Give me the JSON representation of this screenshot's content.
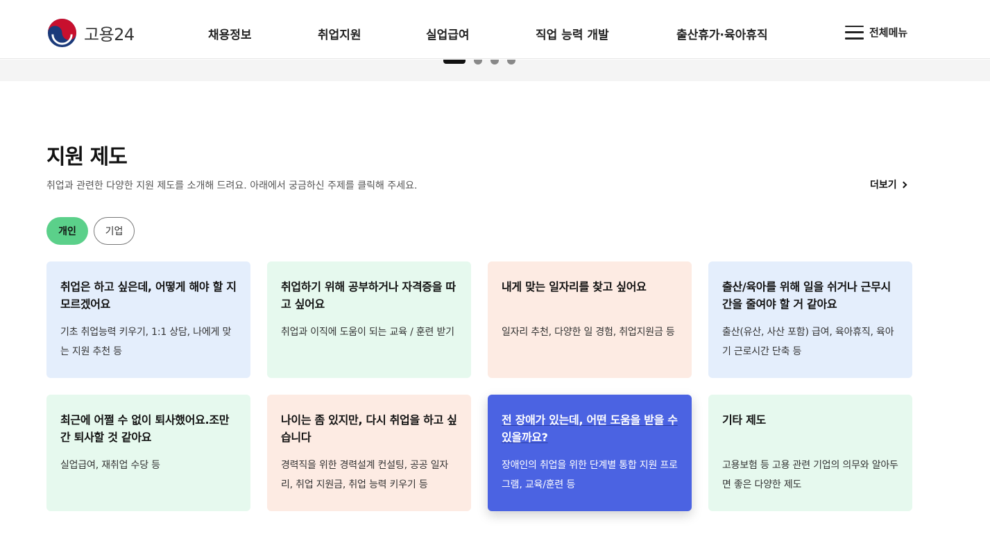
{
  "brand": {
    "logo_text": "고용24",
    "colors": {
      "red": "#c8102e",
      "navy": "#1b3a7a"
    }
  },
  "nav": {
    "items": [
      "채용정보",
      "취업지원",
      "실업급여",
      "직업 능력 개발",
      "출산휴가·육아휴직"
    ],
    "all_menu_label": "전체메뉴"
  },
  "banner": {
    "dot_count": 4,
    "active_dot": 0
  },
  "section": {
    "title": "지원 제도",
    "description": "취업과 관련한 다양한 지원 제도를 소개해 드려요. 아래에서 궁금하신 주제를 클릭해 주세요.",
    "more_label": "더보기"
  },
  "tabs": [
    {
      "label": "개인",
      "selected": true
    },
    {
      "label": "기업",
      "selected": false
    }
  ],
  "cards": [
    {
      "title": "취업은 하고 싶은데, 어떻게 해야 할 지 모르겠어요",
      "desc": "기초 취업능력 키우기, 1:1 상담, 나에게 맞는 지원 추천 등",
      "color": "blue"
    },
    {
      "title": "취업하기 위해 공부하거나 자격증을 따고 싶어요",
      "desc": "취업과 이직에 도움이 되는 교육 / 훈련 받기",
      "color": "green"
    },
    {
      "title": "내게 맞는 일자리를 찾고 싶어요",
      "desc": "일자리 추천, 다양한 일 경험, 취업지원금 등",
      "color": "peach"
    },
    {
      "title": "출산/육아를 위해 일을 쉬거나 근무시간을 줄여야 할 거 같아요",
      "desc": "출산(유산, 사산 포함) 급여, 육아휴직, 육아기 근로시간 단축 등",
      "color": "blue"
    },
    {
      "title": "최근에 어쩔 수 없이 퇴사했어요.조만간 퇴사할 것 같아요",
      "desc": "실업급여, 재취업 수당 등",
      "color": "green"
    },
    {
      "title": "나이는 좀 있지만, 다시 취업을 하고 싶습니다",
      "desc": "경력직을 위한 경력설계 컨설팅, 공공 일자리, 취업 지원금, 취업 능력 키우기 등",
      "color": "peach"
    },
    {
      "title": "전 장애가 있는데, 어떤 도움을 받을 수 있을까요?",
      "desc": "장애인의 취업을 위한 단계별 통합 지원 프로그램, 교육/훈련 등",
      "color": "active"
    },
    {
      "title": "기타 제도",
      "desc": "고용보험 등 고용 관련 기업의 의무와 알아두면 좋은 다양한 제도",
      "color": "green"
    }
  ]
}
